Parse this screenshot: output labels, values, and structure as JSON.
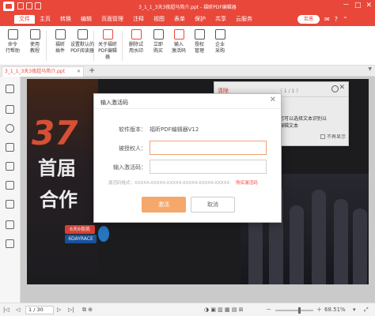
{
  "window": {
    "title": "3_1_1_3天3夜超马简介.ppt - 福昕PDF编辑器",
    "controls": [
      "－",
      "□",
      "✕"
    ]
  },
  "menu": {
    "items": [
      "文件",
      "主页",
      "转换",
      "编辑",
      "页面管理",
      "注释",
      "视图",
      "表单",
      "保护",
      "共享",
      "云服务"
    ],
    "selected_index": 0,
    "user_label": "若愚"
  },
  "ribbon": {
    "tools": [
      {
        "label1": "命令",
        "label2": "行帮助",
        "icon": "command-icon"
      },
      {
        "label1": "使用",
        "label2": "教程",
        "icon": "tutorial-icon"
      },
      {
        "label1": "福昕",
        "label2": "插件",
        "icon": "plugin-icon"
      },
      {
        "label1": "设置默认的",
        "label2": "PDF阅读器",
        "icon": "settings-icon"
      },
      {
        "label1": "关于福昕",
        "label2": "PDF编辑器",
        "icon": "about-icon"
      },
      {
        "label1": "删除试",
        "label2": "用水印",
        "icon": "watermark-icon"
      },
      {
        "label1": "立即",
        "label2": "购买",
        "icon": "cart-icon"
      },
      {
        "label1": "输入",
        "label2": "激活码",
        "icon": "activation-icon"
      },
      {
        "label1": "授权",
        "label2": "管理",
        "icon": "license-icon"
      },
      {
        "label1": "企业",
        "label2": "采购",
        "icon": "enterprise-icon"
      }
    ]
  },
  "tabs": {
    "active_label": "3_1_1_3天3夜超马简介.ppt",
    "close": "✕",
    "add": "+"
  },
  "document": {
    "big37": "37",
    "line2": "首届",
    "line3": "合作",
    "chip1": "6天6夜挑",
    "chip2": "6DAYRACE",
    "nav_top": "⊤ ↑"
  },
  "comment_panel": {
    "clear_label": "清除",
    "page_indicator": "〈  1 / 1  〉",
    "message": "本文。您可以选择文本识别以",
    "message2": "查找、编辑文本",
    "checkbox_label": "不再显示",
    "close": "✕"
  },
  "dialog": {
    "title": "输入激活码",
    "close": "✕",
    "version_label": "软件版本：",
    "version_value": "福昕PDF编辑器V12",
    "licensee_label": "被授权人：",
    "licensee_value": "",
    "code_label": "输入激活码：",
    "code_value": "",
    "format_text": "激活码格式：XXXXX-XXXXX-XXXXX-XXXXX-XXXXX-XXXXX",
    "buy_link": "购买激活码",
    "ok_label": "激活",
    "cancel_label": "取消"
  },
  "status": {
    "page": "1 / 30",
    "zoom": "68.51%"
  }
}
